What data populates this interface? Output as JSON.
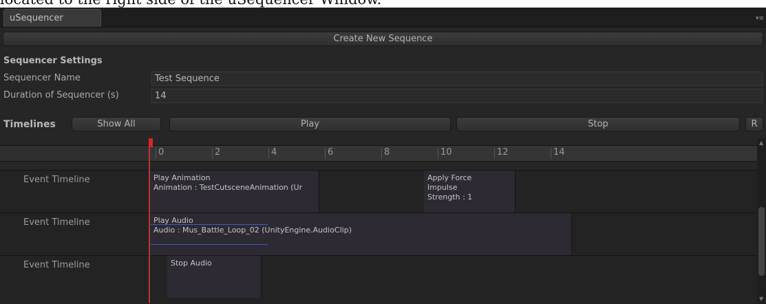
{
  "caption": "located to the right side of the uSequencer Window.",
  "window": {
    "tab_title": "uSequencer",
    "menu_icon": "▾≡"
  },
  "toolbar": {
    "create_button": "Create New Sequence"
  },
  "settings": {
    "heading": "Sequencer Settings",
    "name_label": "Sequencer Name",
    "name_value": "Test Sequence",
    "duration_label": "Duration of Sequencer (s)",
    "duration_value": "14"
  },
  "timelines": {
    "heading": "Timelines",
    "show_all": "Show All",
    "play": "Play",
    "stop": "Stop",
    "record_short": "R"
  },
  "ruler": {
    "ticks": [
      "0",
      "2",
      "4",
      "6",
      "8",
      "10",
      "12",
      "14"
    ]
  },
  "lanes": [
    {
      "label": "Event Timeline",
      "events": [
        {
          "line1": "Play Animation",
          "line2": "Animation : TestCutsceneAnimation (Ur",
          "line3": ""
        },
        {
          "line1": "Apply Force",
          "line2": "Impulse",
          "line3": "Strength : 1"
        }
      ]
    },
    {
      "label": "Event Timeline",
      "events": [
        {
          "line1": "Play Audio",
          "line2": "Audio : Mus_Battle_Loop_02 (UnityEngine.AudioClip)",
          "line3": ""
        }
      ]
    },
    {
      "label": "Event Timeline",
      "events": [
        {
          "line1": "Stop Audio",
          "line2": "",
          "line3": ""
        }
      ]
    }
  ],
  "colors": {
    "playhead": "#cc2222",
    "waveform": "#3a5fbf",
    "event_bg": "#2d2a33"
  }
}
